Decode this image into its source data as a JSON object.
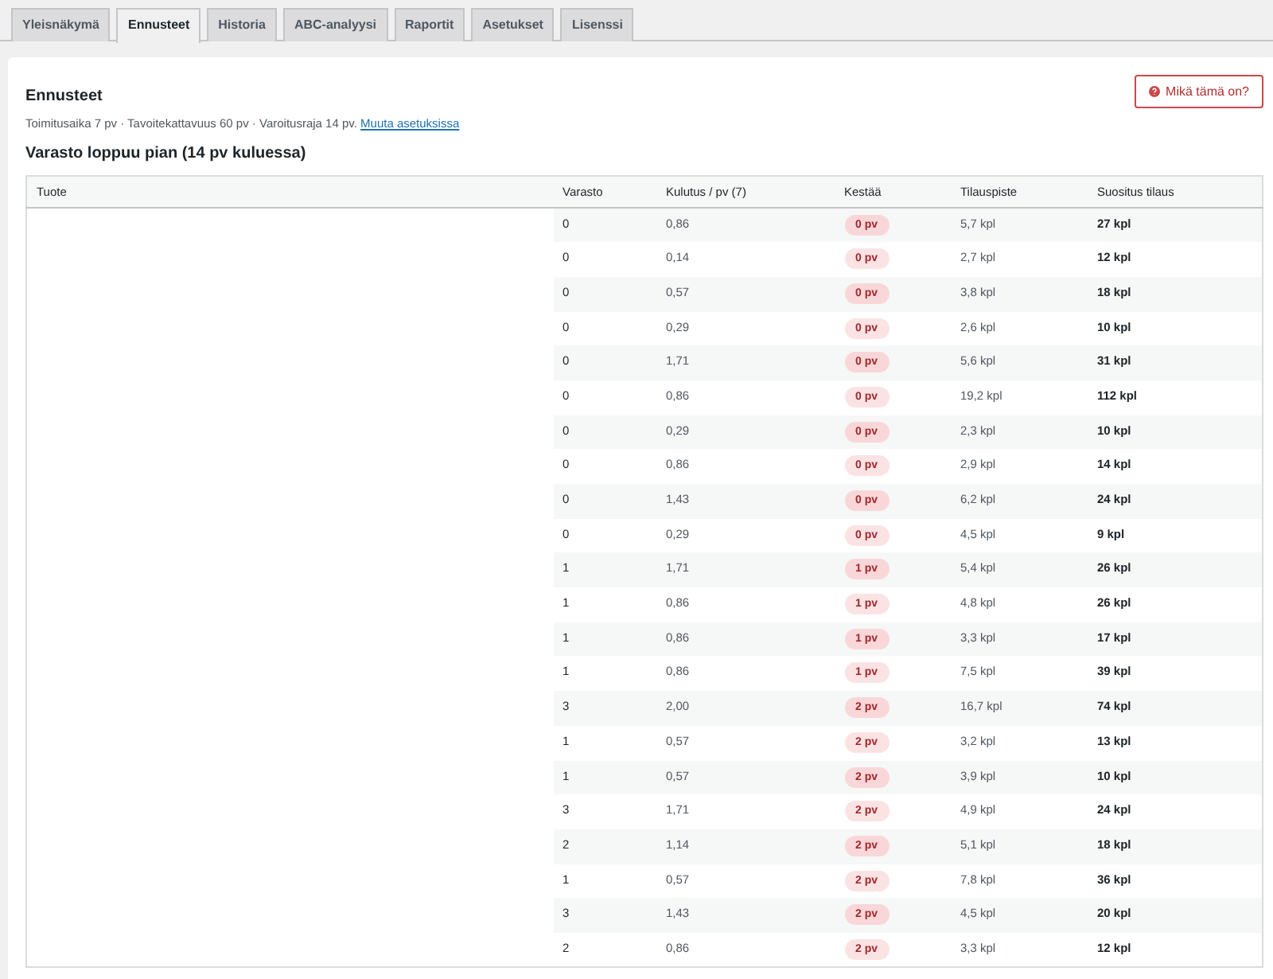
{
  "tabs": [
    {
      "label": "Yleisnäkymä",
      "selected": false
    },
    {
      "label": "Ennusteet",
      "selected": true
    },
    {
      "label": "Historia",
      "selected": false
    },
    {
      "label": "ABC-analyysi",
      "selected": false
    },
    {
      "label": "Raportit",
      "selected": false
    },
    {
      "label": "Asetukset",
      "selected": false
    },
    {
      "label": "Lisenssi",
      "selected": false
    }
  ],
  "panel": {
    "title": "Ennusteet",
    "summary": "Toimitusaika 7 pv · Tavoitekattavuus 60 pv · Varoitusraja 14 pv.",
    "settings_link": "Muuta asetuksissa",
    "help_button": "Mikä tämä on?"
  },
  "section": {
    "title": "Varasto loppuu pian (14 pv kuluessa)"
  },
  "table": {
    "columns": [
      "Tuote",
      "Varasto",
      "Kulutus / pv (7)",
      "Kestää",
      "Tilauspiste",
      "Suositus tilaus"
    ],
    "rows": [
      {
        "stock": "0",
        "usage": "0,86",
        "lasts": "0 pv",
        "reorder_point": "5,7 kpl",
        "suggested": "27 kpl"
      },
      {
        "stock": "0",
        "usage": "0,14",
        "lasts": "0 pv",
        "reorder_point": "2,7 kpl",
        "suggested": "12 kpl"
      },
      {
        "stock": "0",
        "usage": "0,57",
        "lasts": "0 pv",
        "reorder_point": "3,8 kpl",
        "suggested": "18 kpl"
      },
      {
        "stock": "0",
        "usage": "0,29",
        "lasts": "0 pv",
        "reorder_point": "2,6 kpl",
        "suggested": "10 kpl"
      },
      {
        "stock": "0",
        "usage": "1,71",
        "lasts": "0 pv",
        "reorder_point": "5,6 kpl",
        "suggested": "31 kpl"
      },
      {
        "stock": "0",
        "usage": "0,86",
        "lasts": "0 pv",
        "reorder_point": "19,2 kpl",
        "suggested": "112 kpl"
      },
      {
        "stock": "0",
        "usage": "0,29",
        "lasts": "0 pv",
        "reorder_point": "2,3 kpl",
        "suggested": "10 kpl"
      },
      {
        "stock": "0",
        "usage": "0,86",
        "lasts": "0 pv",
        "reorder_point": "2,9 kpl",
        "suggested": "14 kpl"
      },
      {
        "stock": "0",
        "usage": "1,43",
        "lasts": "0 pv",
        "reorder_point": "6,2 kpl",
        "suggested": "24 kpl"
      },
      {
        "stock": "0",
        "usage": "0,29",
        "lasts": "0 pv",
        "reorder_point": "4,5 kpl",
        "suggested": "9 kpl"
      },
      {
        "stock": "1",
        "usage": "1,71",
        "lasts": "1 pv",
        "reorder_point": "5,4 kpl",
        "suggested": "26 kpl"
      },
      {
        "stock": "1",
        "usage": "0,86",
        "lasts": "1 pv",
        "reorder_point": "4,8 kpl",
        "suggested": "26 kpl"
      },
      {
        "stock": "1",
        "usage": "0,86",
        "lasts": "1 pv",
        "reorder_point": "3,3 kpl",
        "suggested": "17 kpl"
      },
      {
        "stock": "1",
        "usage": "0,86",
        "lasts": "1 pv",
        "reorder_point": "7,5 kpl",
        "suggested": "39 kpl"
      },
      {
        "stock": "3",
        "usage": "2,00",
        "lasts": "2 pv",
        "reorder_point": "16,7 kpl",
        "suggested": "74 kpl"
      },
      {
        "stock": "1",
        "usage": "0,57",
        "lasts": "2 pv",
        "reorder_point": "3,2 kpl",
        "suggested": "13 kpl"
      },
      {
        "stock": "1",
        "usage": "0,57",
        "lasts": "2 pv",
        "reorder_point": "3,9 kpl",
        "suggested": "10 kpl"
      },
      {
        "stock": "3",
        "usage": "1,71",
        "lasts": "2 pv",
        "reorder_point": "4,9 kpl",
        "suggested": "24 kpl"
      },
      {
        "stock": "2",
        "usage": "1,14",
        "lasts": "2 pv",
        "reorder_point": "5,1 kpl",
        "suggested": "18 kpl"
      },
      {
        "stock": "1",
        "usage": "0,57",
        "lasts": "2 pv",
        "reorder_point": "7,8 kpl",
        "suggested": "36 kpl"
      },
      {
        "stock": "3",
        "usage": "1,43",
        "lasts": "2 pv",
        "reorder_point": "4,5 kpl",
        "suggested": "20 kpl"
      },
      {
        "stock": "2",
        "usage": "0,86",
        "lasts": "2 pv",
        "reorder_point": "3,3 kpl",
        "suggested": "12 kpl"
      }
    ]
  }
}
